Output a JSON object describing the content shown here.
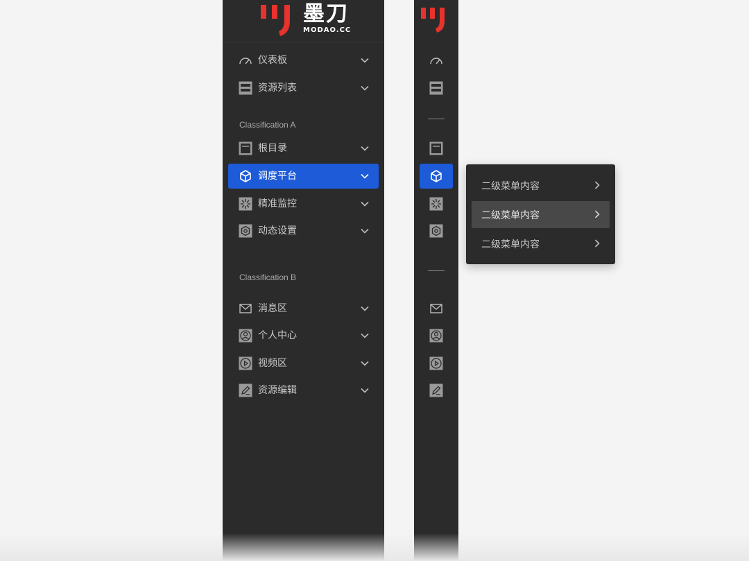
{
  "brand": {
    "name": "墨刀",
    "sub": "MODAO.CC",
    "accent": "#e8322d"
  },
  "colors": {
    "sidebar_bg": "#2b2b2b",
    "active_bg": "#1d5bd8",
    "popup_hover": "#484848"
  },
  "sidebar": {
    "top_items": [
      {
        "label": "仪表板",
        "icon": "dashboard-gauge-icon"
      },
      {
        "label": "资源列表",
        "icon": "server-list-icon"
      }
    ],
    "section_a": {
      "label": "Classification A",
      "items": [
        {
          "label": "根目录",
          "icon": "folder-root-icon"
        },
        {
          "label": "调度平台",
          "icon": "cube-icon",
          "active": true
        },
        {
          "label": "精准监控",
          "icon": "monitor-burst-icon"
        },
        {
          "label": "动态设置",
          "icon": "hexagon-settings-icon"
        }
      ]
    },
    "section_b": {
      "label": "Classification B",
      "items": [
        {
          "label": "消息区",
          "icon": "mail-icon"
        },
        {
          "label": "个人中心",
          "icon": "user-circle-icon"
        },
        {
          "label": "视频区",
          "icon": "play-circle-icon"
        },
        {
          "label": "资源编辑",
          "icon": "edit-pencil-icon"
        }
      ]
    }
  },
  "submenu": {
    "items": [
      {
        "label": "二级菜单内容"
      },
      {
        "label": "二级菜单内容",
        "hover": true
      },
      {
        "label": "二级菜单内容"
      }
    ]
  }
}
